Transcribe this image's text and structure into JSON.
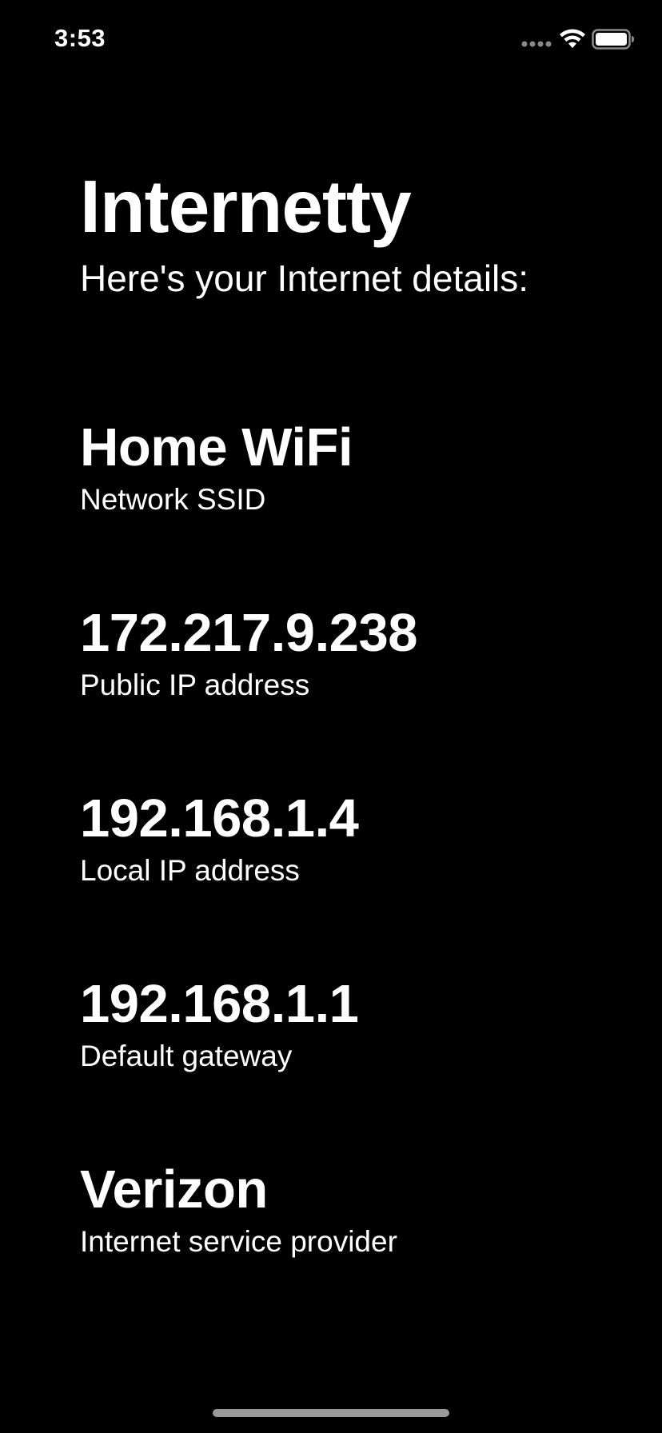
{
  "status_bar": {
    "time": "3:53",
    "icons": [
      "signal-dots-icon",
      "wifi-icon",
      "battery-icon"
    ]
  },
  "header": {
    "title": "Internetty",
    "subtitle": "Here's your Internet details:"
  },
  "info": [
    {
      "value": "Home WiFi",
      "label": "Network SSID"
    },
    {
      "value": "172.217.9.238",
      "label": "Public IP address"
    },
    {
      "value": "192.168.1.4",
      "label": "Local IP address"
    },
    {
      "value": "192.168.1.1",
      "label": "Default gateway"
    },
    {
      "value": "Verizon",
      "label": "Internet service provider"
    }
  ],
  "colors": {
    "background": "#000000",
    "text": "#ffffff",
    "home_indicator": "#9a9a9a"
  }
}
